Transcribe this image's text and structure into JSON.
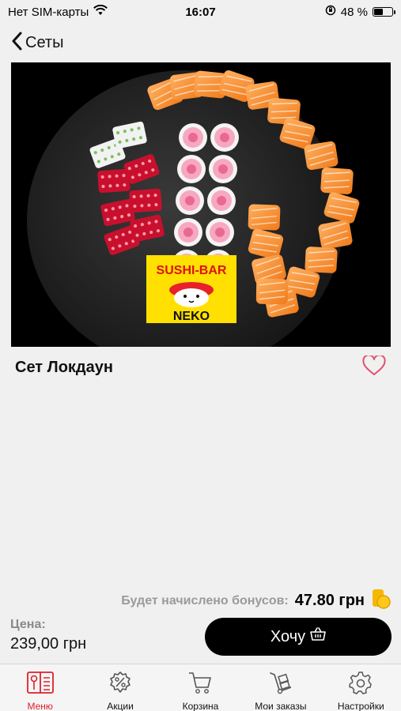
{
  "status_bar": {
    "carrier": "Нет SIM-карты",
    "time": "16:07",
    "battery_percent": "48 %",
    "battery_level": 0.48
  },
  "nav": {
    "back_label": "Сеты"
  },
  "product": {
    "logo_text_top": "SUSHI-BAR",
    "logo_text_bottom": "NEKO",
    "title": "Сет Локдаун",
    "favorite": false
  },
  "bonus": {
    "label": "Будет начислено бонусов:",
    "value": "47.80 грн"
  },
  "price": {
    "label": "Цена:",
    "value": "239,00 грн"
  },
  "action": {
    "want_label": "Хочу"
  },
  "tab_bar": {
    "active": "menu",
    "items": [
      {
        "id": "menu",
        "label": "Меню",
        "icon": "menu-book-icon"
      },
      {
        "id": "promo",
        "label": "Акции",
        "icon": "discount-badge-icon"
      },
      {
        "id": "cart",
        "label": "Корзина",
        "icon": "cart-icon"
      },
      {
        "id": "orders",
        "label": "Мои заказы",
        "icon": "hand-truck-icon"
      },
      {
        "id": "settings",
        "label": "Настройки",
        "icon": "gear-icon"
      }
    ]
  },
  "colors": {
    "accent": "#e0202a",
    "button_bg": "#000000",
    "background": "#f0f0f0",
    "heart": "#e0506a",
    "coin": "#f5b800",
    "logo_bg": "#ffe000"
  }
}
